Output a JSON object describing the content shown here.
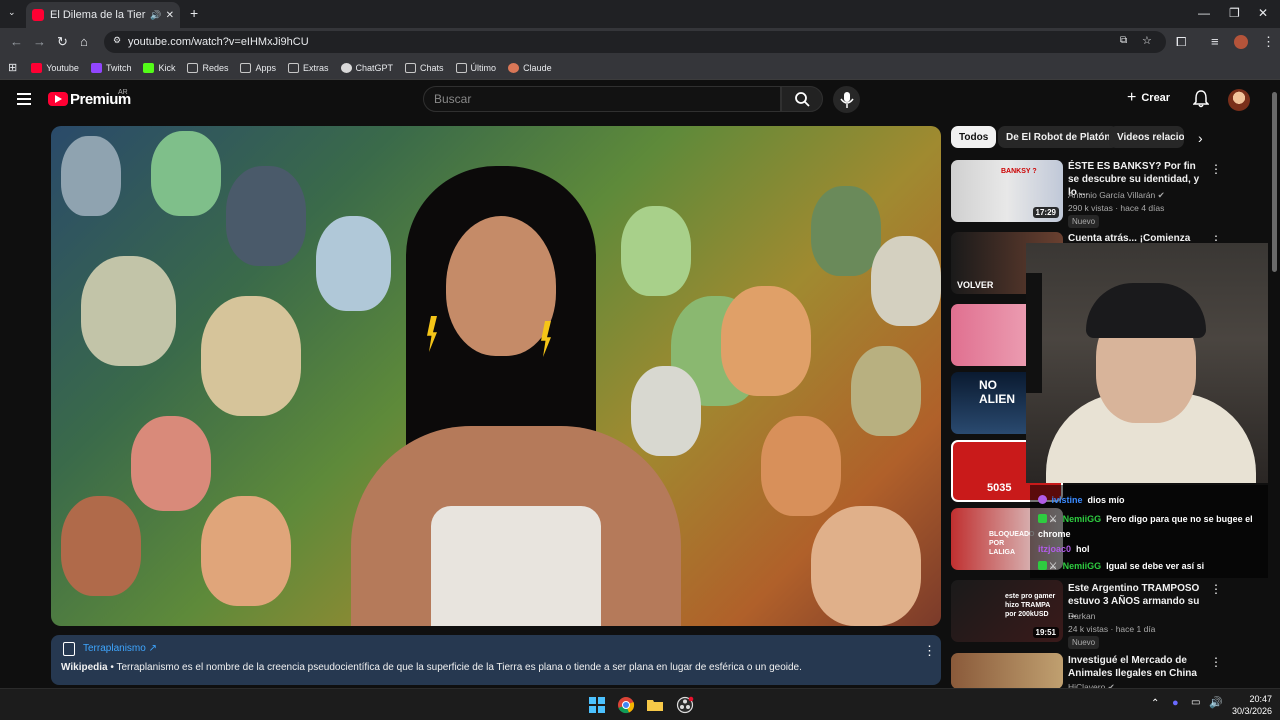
{
  "browser": {
    "tab_title": "El Dilema de la Tierra PAPA",
    "url": "youtube.com/watch?v=eIHMxJi9hCU",
    "bookmarks": [
      {
        "label": "Youtube",
        "color": "#ff0033"
      },
      {
        "label": "Twitch",
        "color": "#9146ff"
      },
      {
        "label": "Kick",
        "color": "#53fc18"
      },
      {
        "label": "Redes",
        "color": "folder"
      },
      {
        "label": "Apps",
        "color": "folder"
      },
      {
        "label": "Extras",
        "color": "folder"
      },
      {
        "label": "ChatGPT",
        "color": "#d9d9d9"
      },
      {
        "label": "Chats",
        "color": "folder"
      },
      {
        "label": "Último",
        "color": "folder"
      },
      {
        "label": "Claude",
        "color": "#d97757"
      }
    ]
  },
  "header": {
    "brand": "Premium",
    "brand_region": "AR",
    "search_placeholder": "Buscar",
    "create_label": "Crear"
  },
  "info_panel": {
    "link": "Terraplanismo ↗",
    "source": "Wikipedia",
    "text": " • Terraplanismo es el nombre de la creencia pseudocientífica de que la superficie de la Tierra es plana o tiende a ser plana en lugar de esférica o un geoide."
  },
  "chips": [
    "Todos",
    "De El Robot de Platón",
    "Videos relacion"
  ],
  "recommendations": [
    {
      "title": "ÉSTE ES BANKSY? Por fin se descubre su identidad, y lo ...",
      "channel": "Antonio García Villarán ✔",
      "meta": "290 k vistas · hace 4 días",
      "badge": "Nuevo",
      "duration": "17:29",
      "thumb_text": "BANKSY ?"
    },
    {
      "title": "Cuenta atrás... ¡Comienza una",
      "thumb_text": "VOLVER"
    },
    {
      "thumb_text": ""
    },
    {
      "thumb_text": "NO ALIEN"
    },
    {
      "thumb_text": "5035"
    },
    {
      "thumb_text": "BLOQUEADO POR LALIGA"
    },
    {
      "title": "Este Argentino TRAMPOSO estuvo 3 AÑOS armando su ...",
      "channel": "Darkan",
      "meta": "24 k vistas · hace 1 día",
      "badge": "Nuevo",
      "duration": "19:51",
      "thumb_text": "este pro gamer hizo TRAMPA por 200kUSD"
    },
    {
      "title": "Investigué el Mercado de Animales Ilegales en China",
      "channel": "HiClavero ✔",
      "thumb_text": ""
    }
  ],
  "chat": [
    {
      "user": "ivistine",
      "msg": "dios mío",
      "user_color": "#3b8bff"
    },
    {
      "user": "NemiiGG",
      "msg": "Pero digo para que no se bugee el chrome",
      "user_color": "#2ecc40"
    },
    {
      "user": "itzjoac0",
      "msg": "hol",
      "user_color": "#b05ce6"
    },
    {
      "user": "NemiiGG",
      "msg": "Igual se debe ver así si",
      "user_color": "#2ecc40"
    }
  ],
  "taskbar": {
    "time": "20:47",
    "date": "30/3/2026"
  }
}
